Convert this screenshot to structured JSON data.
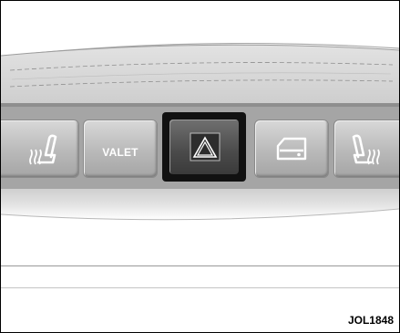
{
  "panel": {
    "buttons": [
      {
        "name": "heated-seat-left-button",
        "icon": "heated-seat-icon"
      },
      {
        "name": "valet-button",
        "label": "VALET"
      },
      {
        "name": "hazard-warning-button",
        "icon": "hazard-triangle-icon"
      },
      {
        "name": "trunk-release-button",
        "icon": "trunk-open-icon"
      },
      {
        "name": "heated-seat-right-button",
        "icon": "heated-seat-icon"
      }
    ]
  },
  "figure_code": "JOL1848"
}
